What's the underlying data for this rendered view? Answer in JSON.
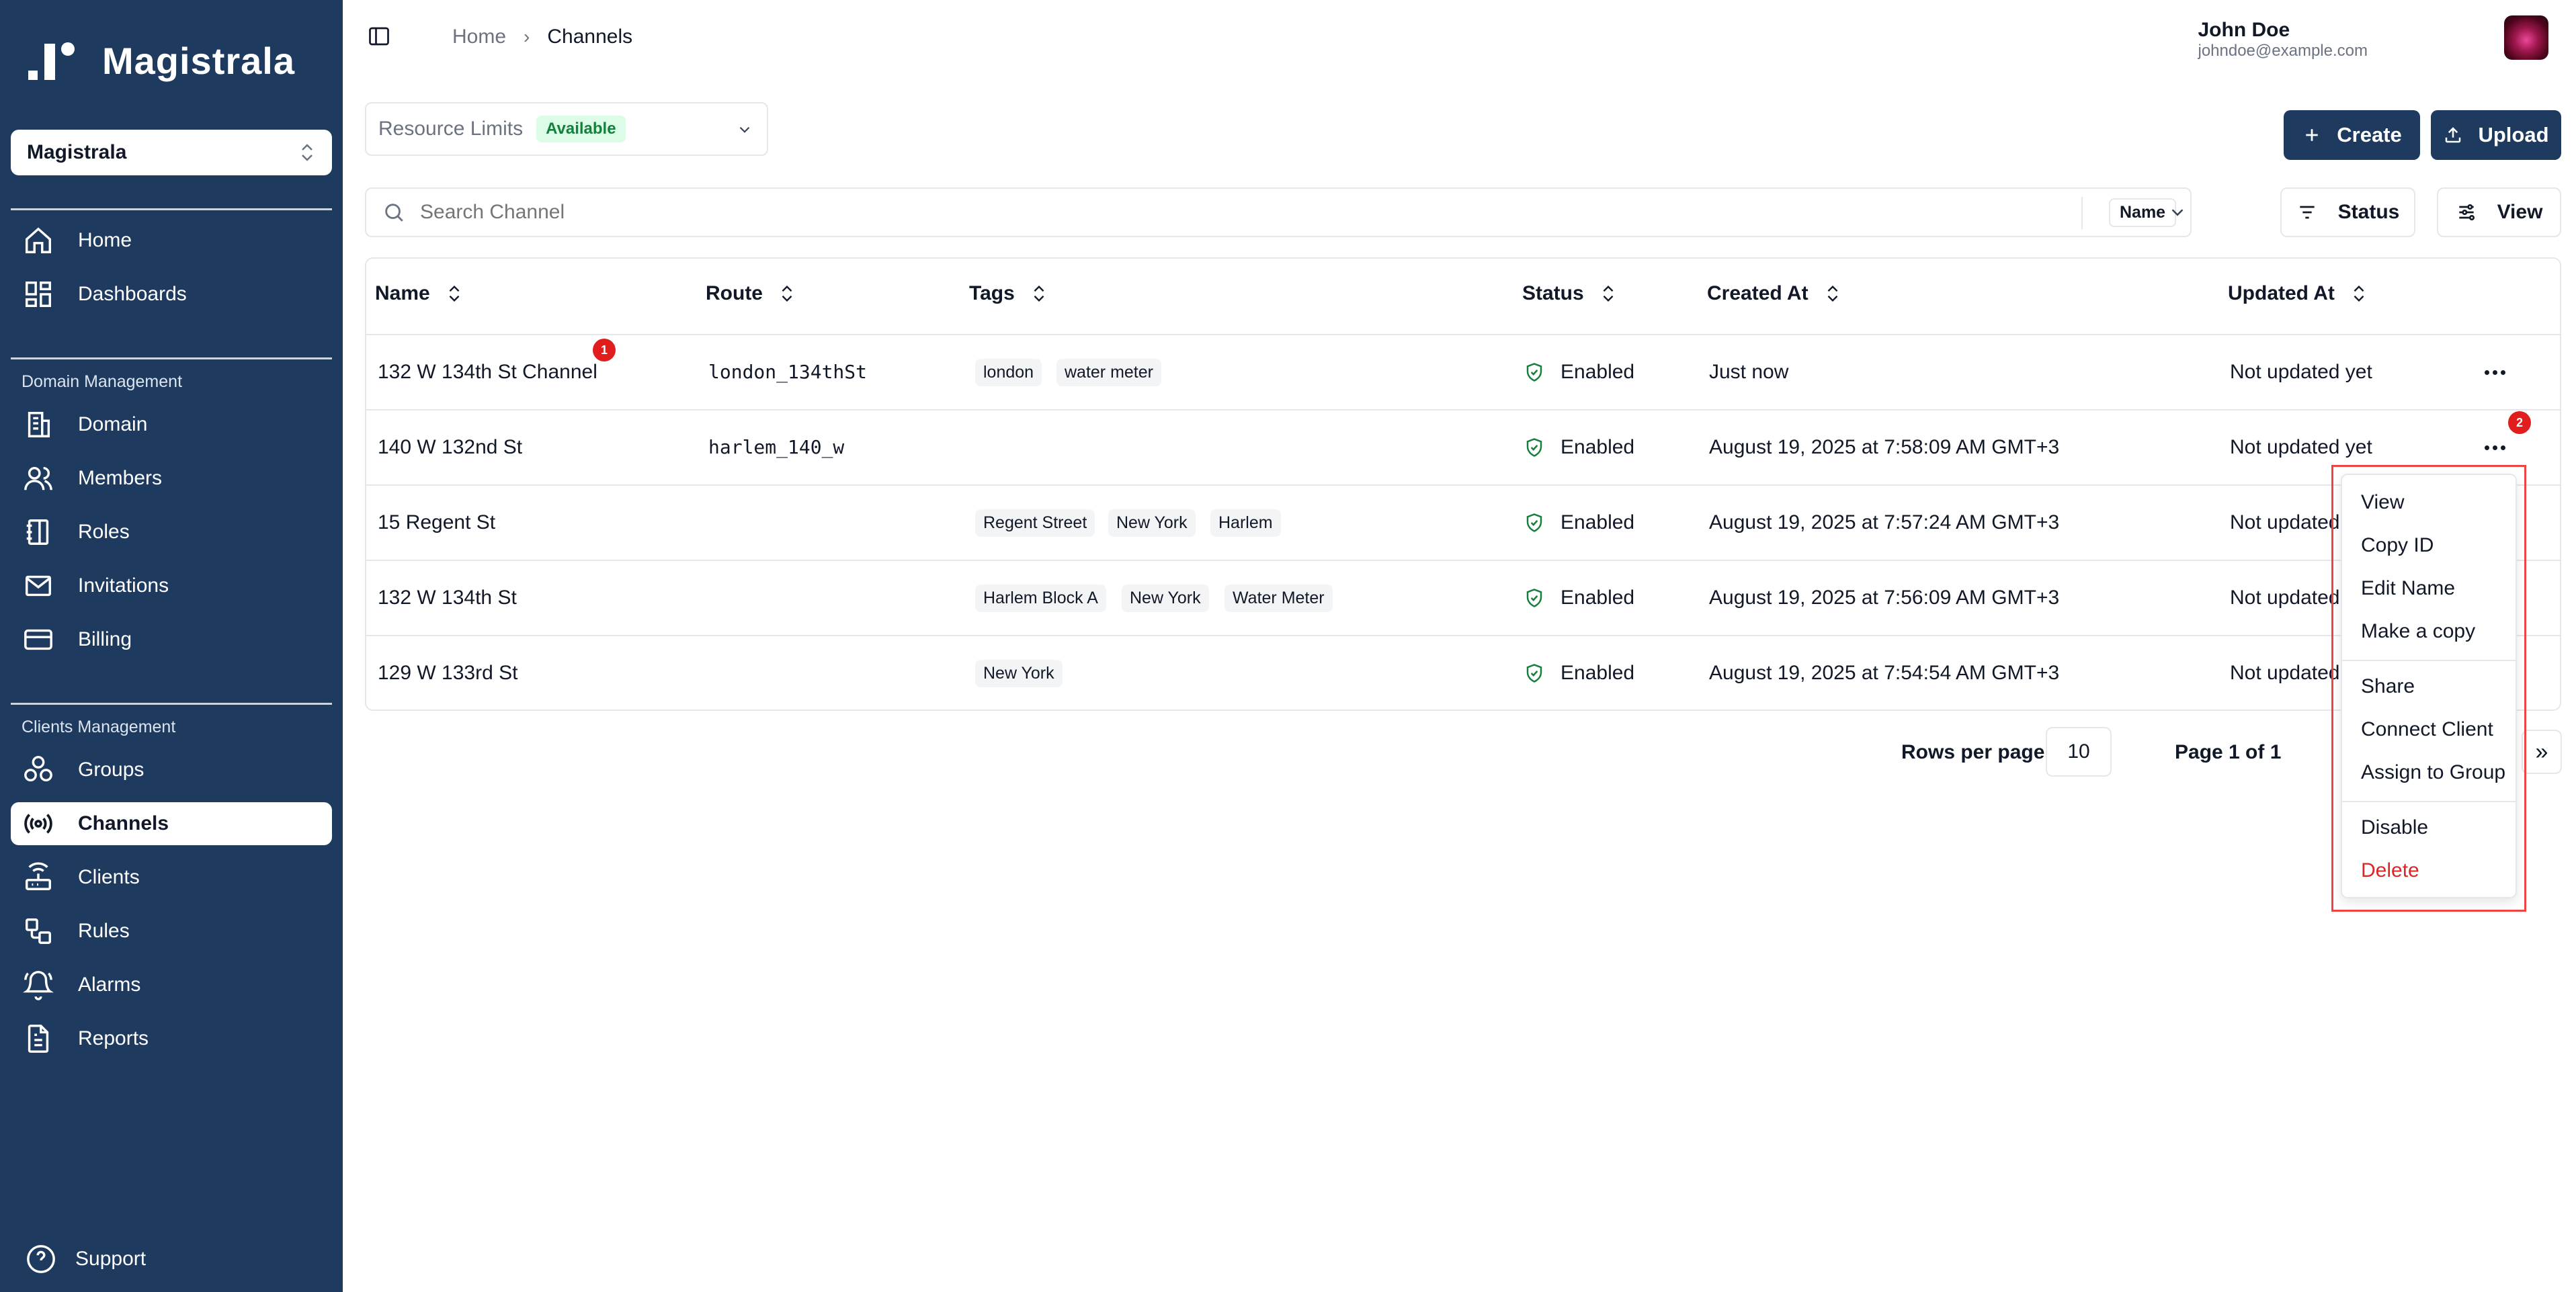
{
  "app": {
    "name": "Magistrala"
  },
  "sidebar": {
    "domain_select": "Magistrala",
    "items": [
      {
        "label": "Home"
      },
      {
        "label": "Dashboards"
      }
    ],
    "domain_section": {
      "label": "Domain Management",
      "items": [
        {
          "label": "Domain"
        },
        {
          "label": "Members"
        },
        {
          "label": "Roles"
        },
        {
          "label": "Invitations"
        },
        {
          "label": "Billing"
        }
      ]
    },
    "clients_section": {
      "label": "Clients Management",
      "items": [
        {
          "label": "Groups"
        },
        {
          "label": "Channels",
          "active": true
        },
        {
          "label": "Clients"
        },
        {
          "label": "Rules"
        },
        {
          "label": "Alarms"
        },
        {
          "label": "Reports"
        }
      ]
    },
    "support": "Support"
  },
  "header": {
    "breadcrumb": [
      "Home",
      "Channels"
    ],
    "user": {
      "name": "John Doe",
      "email": "johndoe@example.com"
    }
  },
  "toolbar": {
    "resource_limits": {
      "label": "Resource Limits",
      "badge": "Available"
    },
    "create": "Create",
    "upload": "Upload",
    "search_placeholder": "Search Channel",
    "search_field": "Name",
    "status": "Status",
    "view": "View"
  },
  "table": {
    "columns": [
      "Name",
      "Route",
      "Tags",
      "Status",
      "Created At",
      "Updated At"
    ],
    "rows": [
      {
        "name": "132 W 134th St Channel",
        "route": "london_134thSt",
        "tags": [
          "london",
          "water meter"
        ],
        "status": "Enabled",
        "created": "Just now",
        "updated": "Not updated yet"
      },
      {
        "name": "140 W 132nd St",
        "route": "harlem_140_w",
        "tags": [],
        "status": "Enabled",
        "created": "August 19, 2025 at 7:58:09 AM GMT+3",
        "updated": "Not updated yet"
      },
      {
        "name": "15 Regent St",
        "route": "",
        "tags": [
          "Regent Street",
          "New York",
          "Harlem"
        ],
        "status": "Enabled",
        "created": "August 19, 2025 at 7:57:24 AM GMT+3",
        "updated": "Not updated"
      },
      {
        "name": "132 W 134th St",
        "route": "",
        "tags": [
          "Harlem Block A",
          "New York",
          "Water Meter"
        ],
        "status": "Enabled",
        "created": "August 19, 2025 at 7:56:09 AM GMT+3",
        "updated": "Not updated"
      },
      {
        "name": "129 W 133rd St",
        "route": "",
        "tags": [
          "New York"
        ],
        "status": "Enabled",
        "created": "August 19, 2025 at 7:54:54 AM GMT+3",
        "updated": "Not updated"
      }
    ]
  },
  "annotations": {
    "badge1": "1",
    "badge2": "2"
  },
  "pagination": {
    "rows_label": "Rows per page",
    "rows_value": "10",
    "page_label": "Page 1 of 1",
    "last_glyph": "»"
  },
  "context_menu": {
    "items": [
      "View",
      "Copy ID",
      "Edit Name",
      "Make a copy",
      "Share",
      "Connect Client",
      "Assign to Group",
      "Disable",
      "Delete"
    ]
  },
  "colors": {
    "sidebar": "#1e3a5f",
    "accent": "#1e3a5f",
    "danger": "#dc2626",
    "success": "#15803d"
  }
}
